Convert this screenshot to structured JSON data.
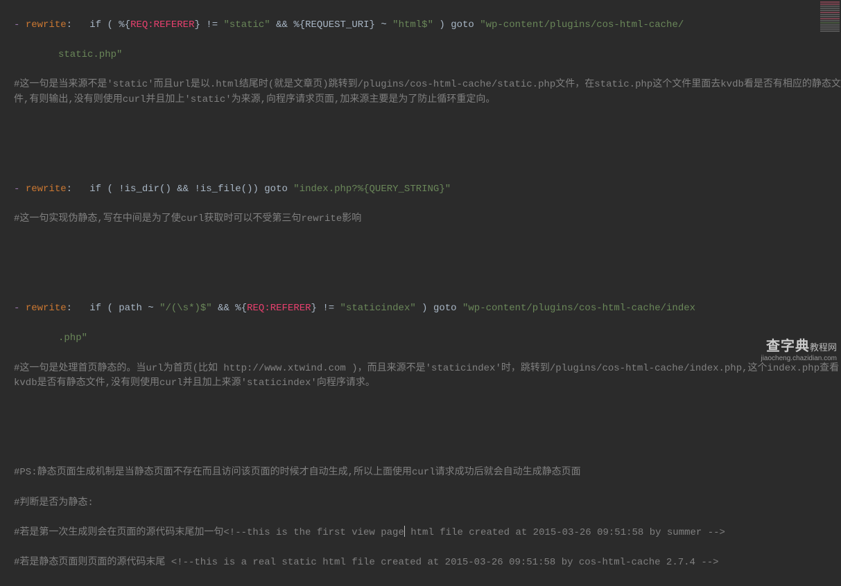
{
  "l1": {
    "dash": "- ",
    "key": "rewrite",
    "colon": ":   ",
    "if": "if ( ",
    "pct1": "%{",
    "req1": "REQ:REFERER",
    "close1": "}",
    "ne": " != ",
    "s1": "\"static\"",
    "and": " && ",
    "pct2": "%{REQUEST_URI}",
    "tilde": " ~ ",
    "s2": "\"html$\"",
    "endp": " ) goto ",
    "s3a": "\"wp-content/plugins/cos-html-cache/",
    "s3b": "static.php\""
  },
  "c1": "#这一句是当来源不是'static'而且url是以.html结尾时(就是文章页)跳转到/plugins/cos-html-cache/static.php文件，在static.php这个文件里面去kvdb看是否有相应的静态文件,有则输出,没有则使用curl并且加上'static'为来源,向程序请求页面,加来源主要是为了防止循环重定向。",
  "l2": {
    "dash": "- ",
    "key": "rewrite",
    "colon": ":   ",
    "body": "if ( !is_dir() && !is_file()) goto ",
    "s1": "\"index.php?%{QUERY_STRING}\""
  },
  "c2": "#这一句实现伪静态,写在中间是为了使curl获取时可以不受第三句rewrite影响",
  "l3": {
    "dash": "- ",
    "key": "rewrite",
    "colon": ":   ",
    "if": "if ( path ~ ",
    "s1": "\"/(\\s*)$\"",
    "and": " && ",
    "pct1": "%{",
    "req1": "REQ:REFERER",
    "close1": "}",
    "ne": " != ",
    "s2": "\"staticindex\"",
    "endp": " ) goto ",
    "s3a": "\"wp-content/plugins/cos-html-cache/index",
    "s3b": ".php\""
  },
  "c3": "#这一句是处理首页静态的。当url为首页(比如 http://www.xtwind.com )，而且来源不是'staticindex'时，跳转到/plugins/cos-html-cache/index.php,这个index.php查看kvdb是否有静态文件,没有则使用curl并且加上来源'staticindex'向程序请求。",
  "c4": "#PS:静态页面生成机制是当静态页面不存在而且访问该页面的时候才自动生成,所以上面使用curl请求成功后就会自动生成静态页面",
  "c5": "#判断是否为静态:",
  "c6a": "#若是第一次生成则会在页面的源代码末尾加一句<!--this is the first view page",
  "c6b": " html file created at 2015-03-26 09:51:58 by summer -->",
  "c7": "#若是静态页面则页面的源代码末尾 <!--this is a real static html file created at 2015-03-26 09:51:58 by cos-html-cache 2.7.4 -->",
  "watermark": {
    "big": "查字典",
    "suffix": "教程网",
    "url": "jiaocheng.chazidian.com"
  }
}
